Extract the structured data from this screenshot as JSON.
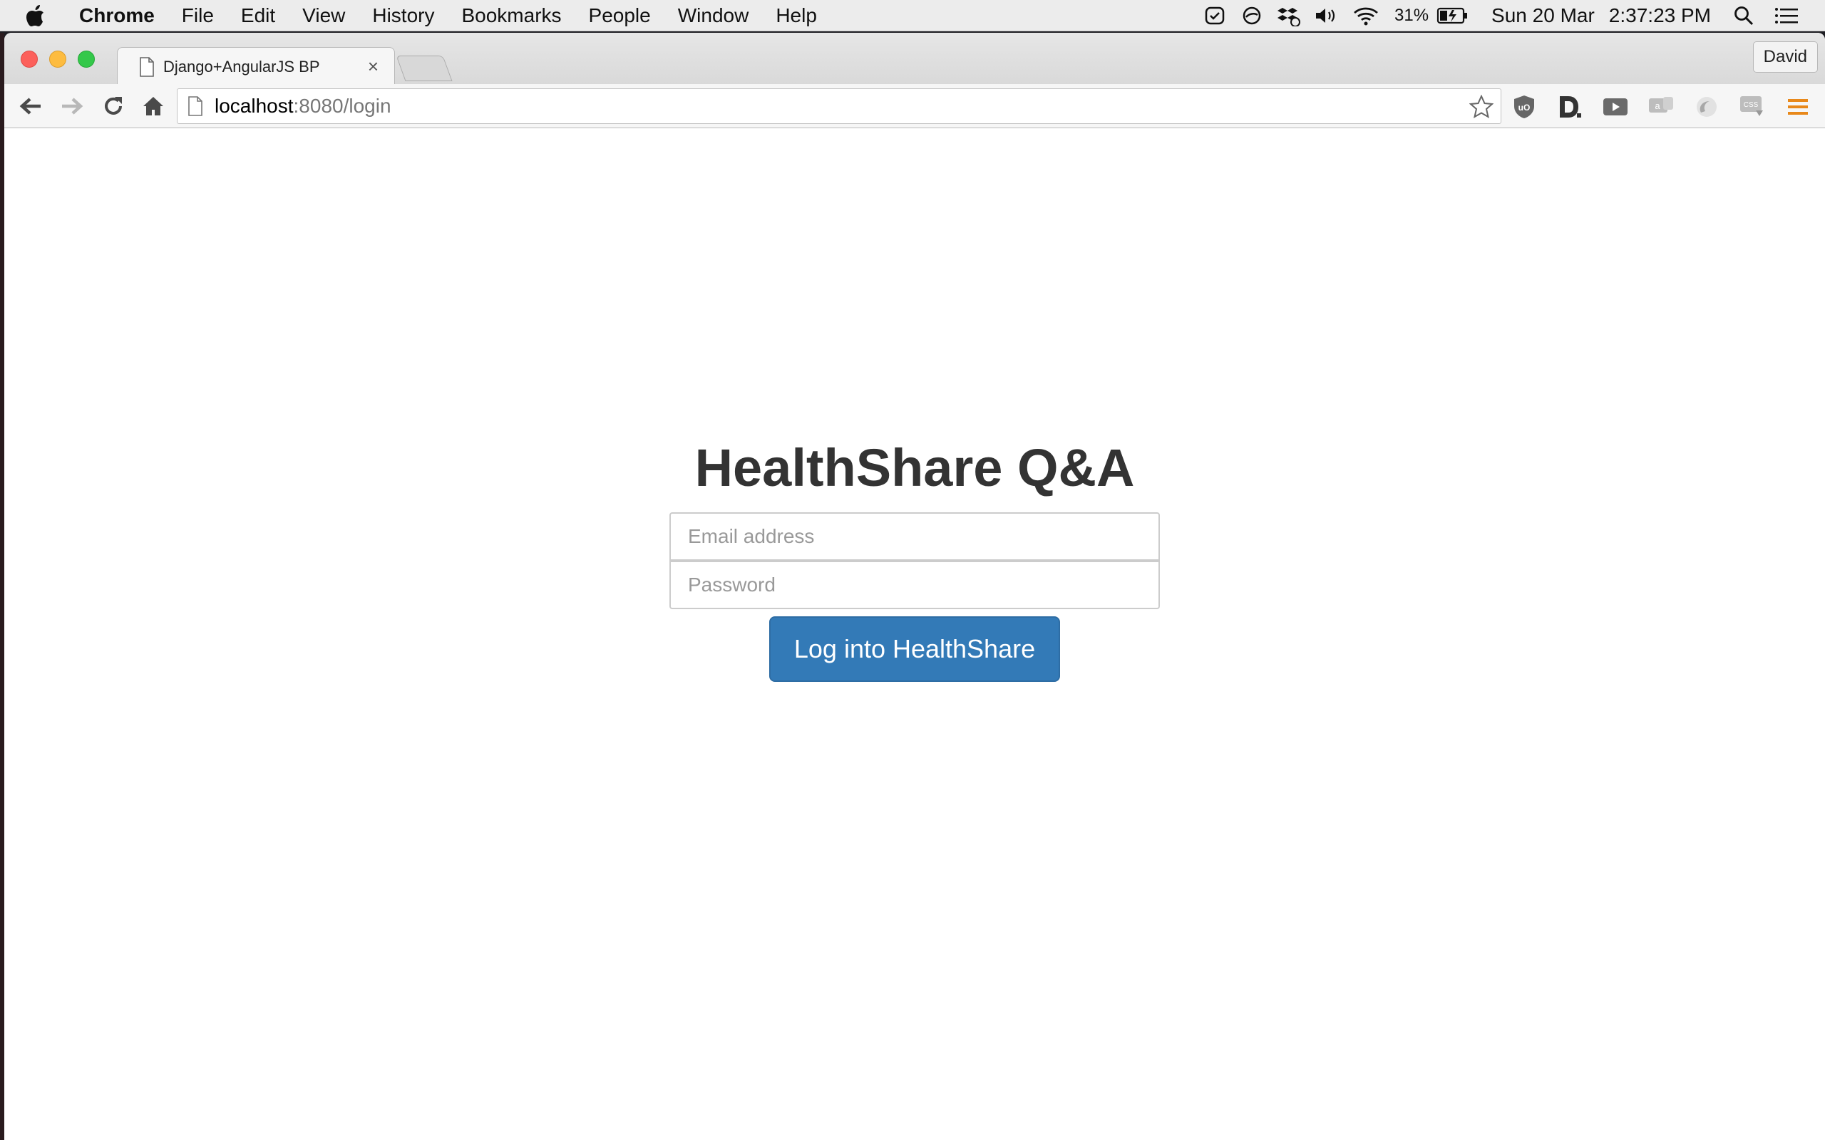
{
  "menubar": {
    "app_name": "Chrome",
    "items": [
      "File",
      "Edit",
      "View",
      "History",
      "Bookmarks",
      "People",
      "Window",
      "Help"
    ],
    "battery": "31%",
    "date": "Sun 20 Mar",
    "time": "2:37:23 PM",
    "icons": [
      "apple-logo",
      "checkmark-shield-icon",
      "circle-slash-icon",
      "dropbox-sync-icon",
      "volume-icon",
      "wifi-icon",
      "battery-charging-icon",
      "spotlight-search-icon",
      "notification-center-icon"
    ]
  },
  "browser": {
    "tab_title": "Django+AngularJS BP",
    "tab_close": "×",
    "profile_name": "David",
    "url_host": "localhost",
    "url_rest": ":8080/login",
    "extensions": [
      "ublock-icon",
      "d-extension-icon",
      "video-extension-icon",
      "chat-extension-icon",
      "swirl-extension-icon",
      "css-extension-icon",
      "chrome-menu-icon"
    ]
  },
  "login": {
    "title": "HealthShare Q&A",
    "email_placeholder": "Email address",
    "password_placeholder": "Password",
    "submit_label": "Log into HealthShare"
  },
  "colors": {
    "button_primary": "#337ab7",
    "heading_text": "#333333",
    "chrome_menu_accent": "#e8881a"
  }
}
